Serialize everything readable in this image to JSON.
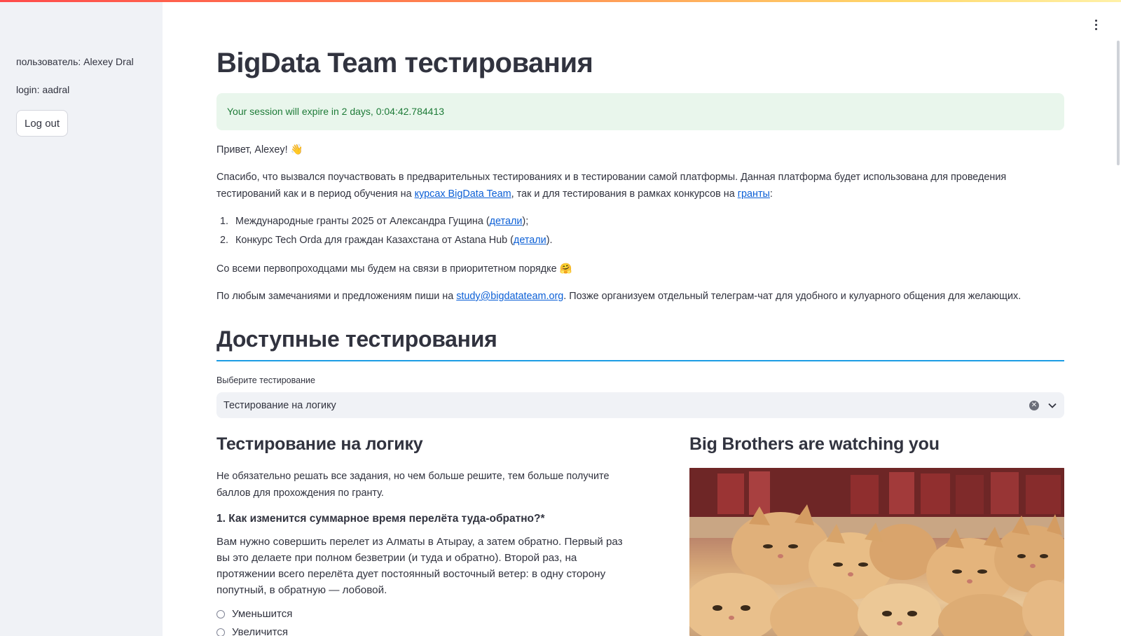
{
  "sidebar": {
    "user_line": "пользователь: Alexey Dral",
    "login_line": "login: aadral",
    "logout_label": "Log out"
  },
  "page": {
    "title": "BigData Team тестирования",
    "session_alert": "Your session will expire in 2 days, 0:04:42.784413",
    "greeting": "Привет, Alexey! 👋",
    "intro_text": "Спасибо, что вызвался поучаствовать в предварительных тестированиях и в тестировании самой платформы. Данная платформа будет использована для проведения тестирований как и в период обучения на ",
    "intro_link_courses": "курсах BigData Team",
    "intro_mid": ", так и для тестирования в рамках конкурсов на ",
    "intro_link_grants": "гранты",
    "intro_end": ":",
    "grants": [
      {
        "num": "1.",
        "text": "Международные гранты 2025 от Александра Гущина (",
        "link": "детали",
        "tail": ");"
      },
      {
        "num": "2.",
        "text": "Конкурс Tech Orda для граждан Казахстана от Astana Hub (",
        "link": "детали",
        "tail": ")."
      }
    ],
    "pioneers": "Со всеми первопроходцами мы будем на связи в приоритетном порядке 🤗",
    "contact_pre": "По любым замечаниями и предложениям пиши на ",
    "contact_email": "study@bigdatateam.org",
    "contact_post": ". Позже организуем отдельный телеграм-чат для удобного и кулуарного общения для желающих."
  },
  "tests": {
    "heading": "Доступные тестирования",
    "select_label": "Выберите тестирование",
    "select_value": "Тестирование на логику"
  },
  "logic_test": {
    "heading": "Тестирование на логику",
    "description": "Не обязательно решать все задания, но чем больше решите, тем больше получите баллов для прохождения по гранту.",
    "question_title": "1. Как изменится суммарное время перелёта туда-обратно?*",
    "question_body": "Вам нужно совершить перелет из Алматы в Атырау, а затем обратно. Первый раз вы это делаете при полном безветрии (и туда и обратно). Второй раз, на протяжении всего перелёта дует постоянный восточный ветер: в одну сторону попутный, в обратную — лобовой.",
    "options": [
      "Уменьшится",
      "Увеличится"
    ]
  },
  "image_panel": {
    "heading": "Big Brothers are watching you"
  },
  "colors": {
    "accent_line": "#1c9ce4",
    "alert_bg": "#e9f6ec",
    "alert_text": "#1e7b38",
    "sidebar_bg": "#f0f2f6",
    "link": "#0b5fd6"
  }
}
